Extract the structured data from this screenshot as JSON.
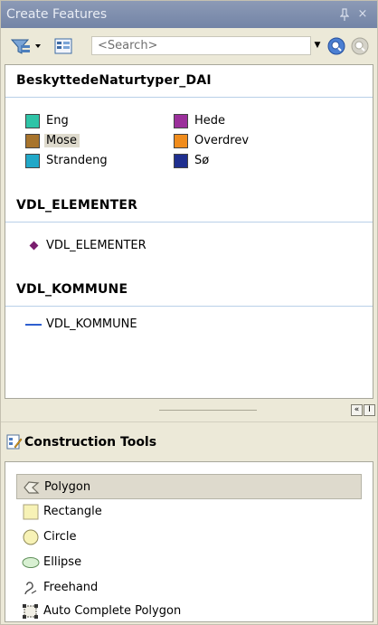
{
  "window": {
    "title": "Create Features",
    "pin_glyph": "↕",
    "close_glyph": "×"
  },
  "toolbar": {
    "search_placeholder": "<Search>",
    "dropdown_glyph": "▼"
  },
  "groups": [
    {
      "title": "BeskyttedeNaturtyper_DAI",
      "templates": [
        {
          "label": "Eng",
          "color": "#2fc4a7",
          "selected": false
        },
        {
          "label": "Hede",
          "color": "#9b2f9b",
          "selected": false
        },
        {
          "label": "Mose",
          "color": "#a8742c",
          "selected": true
        },
        {
          "label": "Overdrev",
          "color": "#f08c1c",
          "selected": false
        },
        {
          "label": "Strandeng",
          "color": "#21a8c8",
          "selected": false
        },
        {
          "label": "Sø",
          "color": "#1f2f8f",
          "selected": false
        }
      ]
    },
    {
      "title": "VDL_ELEMENTER",
      "templates": [
        {
          "label": "VDL_ELEMENTER",
          "color": "#7a1e6e"
        }
      ]
    },
    {
      "title": "VDL_KOMMUNE",
      "templates": [
        {
          "label": "VDL_KOMMUNE",
          "color": "#2e5fd0"
        }
      ]
    }
  ],
  "splitter": {
    "collapse_glyph": "«",
    "other_glyph": "I"
  },
  "construction_tools": {
    "title": "Construction Tools",
    "tools": [
      {
        "label": "Polygon",
        "icon": "polygon-icon",
        "selected": true
      },
      {
        "label": "Rectangle",
        "icon": "rectangle-icon",
        "selected": false
      },
      {
        "label": "Circle",
        "icon": "circle-icon",
        "selected": false
      },
      {
        "label": "Ellipse",
        "icon": "ellipse-icon",
        "selected": false
      },
      {
        "label": "Freehand",
        "icon": "freehand-icon",
        "selected": false
      },
      {
        "label": "Auto Complete Polygon",
        "icon": "auto-complete-polygon-icon",
        "selected": false
      }
    ]
  }
}
